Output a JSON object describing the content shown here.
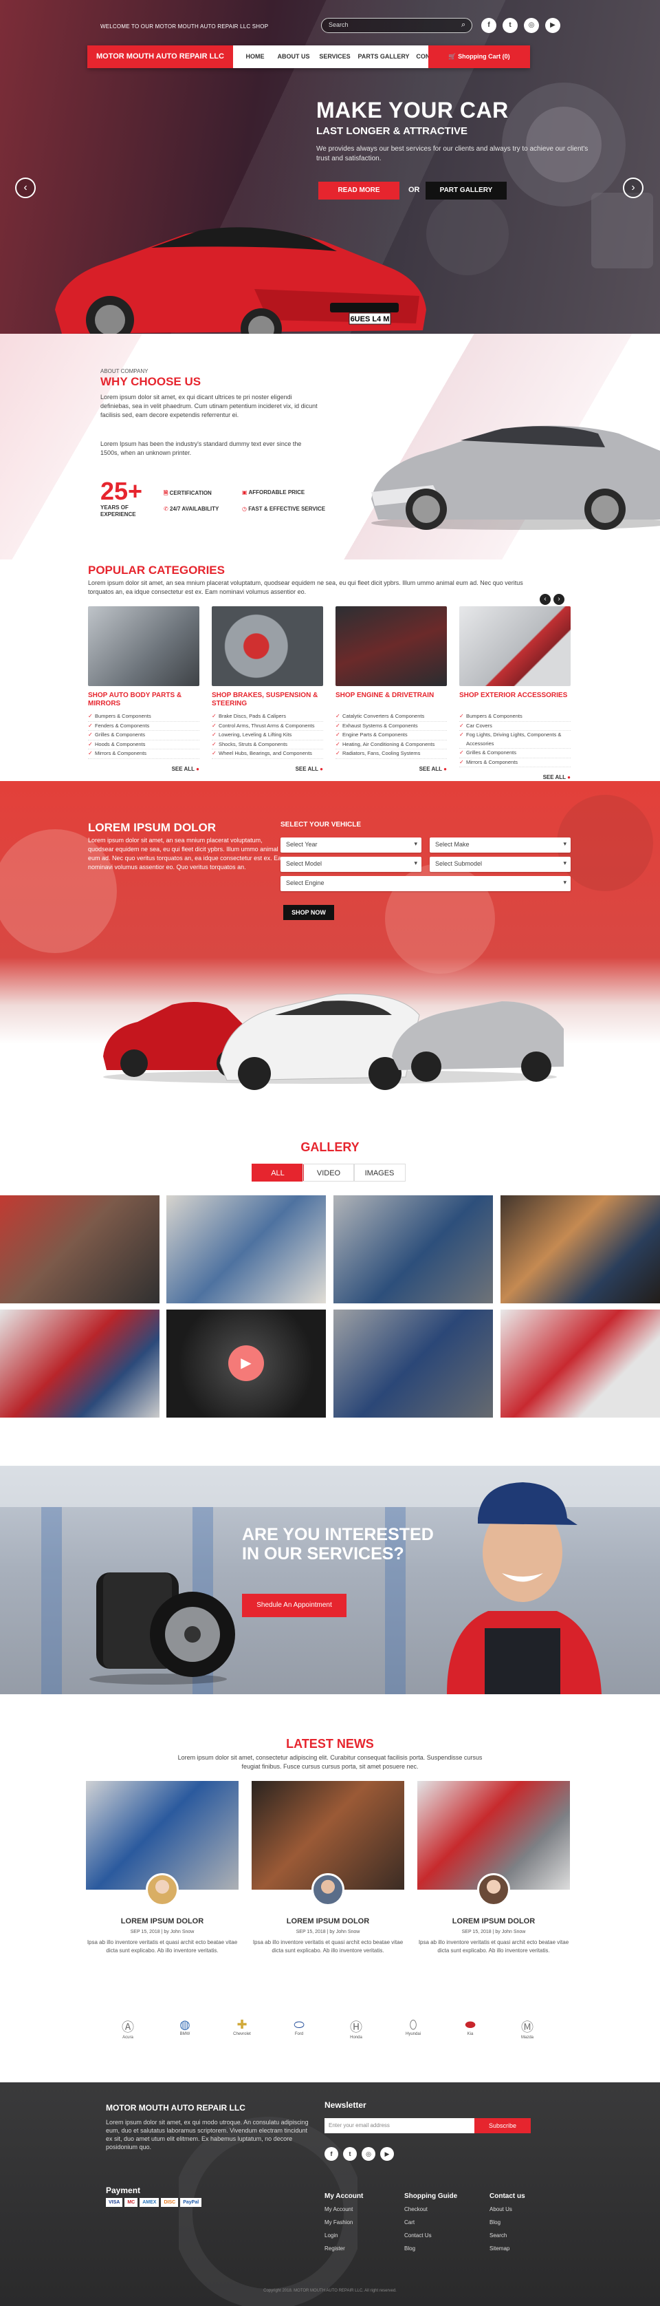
{
  "topbar": {
    "welcome": "WELCOME TO OUR MOTOR MOUTH AUTO REPAIR LLC SHOP",
    "search_placeholder": "Search",
    "social": [
      "f",
      "t",
      "◎",
      "▶"
    ]
  },
  "nav": {
    "brand": "MOTOR MOUTH AUTO REPAIR LLC",
    "items": [
      "HOME",
      "ABOUT US",
      "SERVICES",
      "PARTS GALLERY",
      "CONTACT"
    ],
    "cart": "Shopping Cart (0)"
  },
  "hero": {
    "title": "MAKE YOUR CAR",
    "subtitle": "LAST LONGER & ATTRACTIVE",
    "text": "We provides always our best services for our clients and always try to achieve our client's trust and satisfaction.",
    "read_more": "READ MORE",
    "or": "OR",
    "part_gallery": "PART GALLERY",
    "plate": "6UES L4 M"
  },
  "why": {
    "label": "ABOUT COMPANY",
    "title": "WHY CHOOSE US",
    "p1": "Lorem ipsum dolor sit amet, ex qui dicant ultrices te pri noster eligendi definiebas, sea in velit phaedrum. Cum utinam petentium incideret vix, id dicunt facilisis sed, eam decore expetendis referrentur ei.",
    "p2": "Lorem Ipsum has been the industry's standard dummy text ever since the 1500s, when an unknown printer.",
    "years": "25+",
    "years_label1": "YEARS OF",
    "years_label2": "EXPERIENCE",
    "features": [
      "CERTIFICATION",
      "AFFORDABLE PRICE",
      "24/7 AVAILABILITY",
      "FAST & EFFECTIVE SERVICE"
    ]
  },
  "categories": {
    "title": "POPULAR CATEGORIES",
    "text": "Lorem ipsum dolor sit amet, an sea mnium placerat voluptatum, quodsear equidem ne sea, eu qui fleet dicit ypbrs. Illum ummo animal eum ad. Nec quo veritus torquatos an, ea idque consectetur est ex. Eam nominavi volumus assentior eo.",
    "see_all": "SEE ALL",
    "items": [
      {
        "title": "SHOP AUTO BODY PARTS & MIRRORS",
        "list": [
          "Bumpers & Components",
          "Fenders & Components",
          "Grilles & Components",
          "Hoods & Components",
          "Mirrors & Components"
        ]
      },
      {
        "title": "SHOP BRAKES, SUSPENSION & STEERING",
        "list": [
          "Brake Discs, Pads & Calipers",
          "Control Arms, Thrust Arms & Components",
          "Lowering, Leveling & Lifting Kits",
          "Shocks, Struts & Components",
          "Wheel Hubs, Bearings, and Components"
        ]
      },
      {
        "title": "SHOP ENGINE & DRIVETRAIN",
        "list": [
          "Catalytic Converters & Components",
          "Exhaust Systems & Components",
          "Engine Parts & Components",
          "Heating, Air Conditioning & Components",
          "Radiators, Fans, Cooling Systems"
        ]
      },
      {
        "title": "SHOP EXTERIOR ACCESSORIES",
        "list": [
          "Bumpers & Components",
          "Car Covers",
          "Fog Lights, Driving Lights, Components & Accessories",
          "Grilles & Components",
          "Mirrors & Components"
        ]
      }
    ]
  },
  "vehicle": {
    "title": "LOREM IPSUM DOLOR",
    "text": "Lorem ipsum dolor sit amet, an sea mnium placerat voluptatum, quodsear equidem ne sea, eu qui fleet dicit ypbrs. Illum ummo animal eum ad. Nec quo veritus torquatos an, ea idque consectetur est ex. Eam nominavi volumus assentior eo. Quo veritus torquatos an.",
    "select_title": "SELECT YOUR VEHICLE",
    "selects": [
      "Select Year",
      "Select Make",
      "Select Model",
      "Select Submodel",
      "Select Engine"
    ],
    "shop_now": "SHOP NOW"
  },
  "gallery": {
    "title": "GALLERY",
    "tabs": [
      "ALL",
      "VIDEO",
      "IMAGES"
    ]
  },
  "interested": {
    "line1": "ARE YOU INTERESTED",
    "line2": "IN OUR SERVICES?",
    "button": "Shedule An Appointment"
  },
  "news": {
    "title": "LATEST NEWS",
    "text": "Lorem ipsum dolor sit amet, consectetur adipiscing elit. Curabitur consequat facilisis porta. Suspendisse cursus feugiat finibus. Fusce cursus cursus porta, sit amet posuere nec.",
    "cards": [
      {
        "title": "LOREM IPSUM DOLOR",
        "meta": "SEP 15, 2018  |  by John Snow",
        "text": "Ipsa ab illo inventore veritatis et quasi archit ecto beatae vitae dicta sunt explicabo. Ab illo inventore veritatis."
      },
      {
        "title": "LOREM IPSUM DOLOR",
        "meta": "SEP 15, 2018  |  by John Snow",
        "text": "Ipsa ab illo inventore veritatis et quasi archit ecto beatae vitae dicta sunt explicabo. Ab illo inventore veritatis."
      },
      {
        "title": "LOREM IPSUM DOLOR",
        "meta": "SEP 15, 2018  |  by John Snow",
        "text": "Ipsa ab illo inventore veritatis et quasi archit ecto beatae vitae dicta sunt explicabo. Ab illo inventore veritatis."
      }
    ]
  },
  "brands": [
    "Acura",
    "BMW",
    "Chevrolet",
    "Ford",
    "Honda",
    "Hyundai",
    "Kia",
    "Mazda"
  ],
  "footer": {
    "company": "MOTOR MOUTH AUTO REPAIR LLC",
    "about": "Lorem ipsum dolor sit amet, ex qui modo utroque. An consulatu adipiscing eum, duo et salutatus laboramus scriptorem. Vivendum electram tincidunt ex sit, duo amet utum elit elitmem. Ex habemus luptatum, no decore posidonium quo.",
    "payment": "Payment",
    "cards": [
      "VISA",
      "MC",
      "AMEX",
      "DISC",
      "PayPal"
    ],
    "newsletter": "Newsletter",
    "email_placeholder": "Enter your email address",
    "subscribe": "Subscribe",
    "social": [
      "f",
      "t",
      "◎",
      "▶"
    ],
    "cols": [
      {
        "title": "My Account",
        "links": [
          "My Account",
          "My Fashion",
          "Login",
          "Register"
        ]
      },
      {
        "title": "Shopping Guide",
        "links": [
          "Checkout",
          "Cart",
          "Contact Us",
          "Blog"
        ]
      },
      {
        "title": "Contact us",
        "links": [
          "About Us",
          "Blog",
          "Search",
          "Sitemap"
        ]
      }
    ],
    "copyright": "Copyright 2018. MOTOR MOUTH AUTO REPAIR LLC. All right reserved."
  }
}
